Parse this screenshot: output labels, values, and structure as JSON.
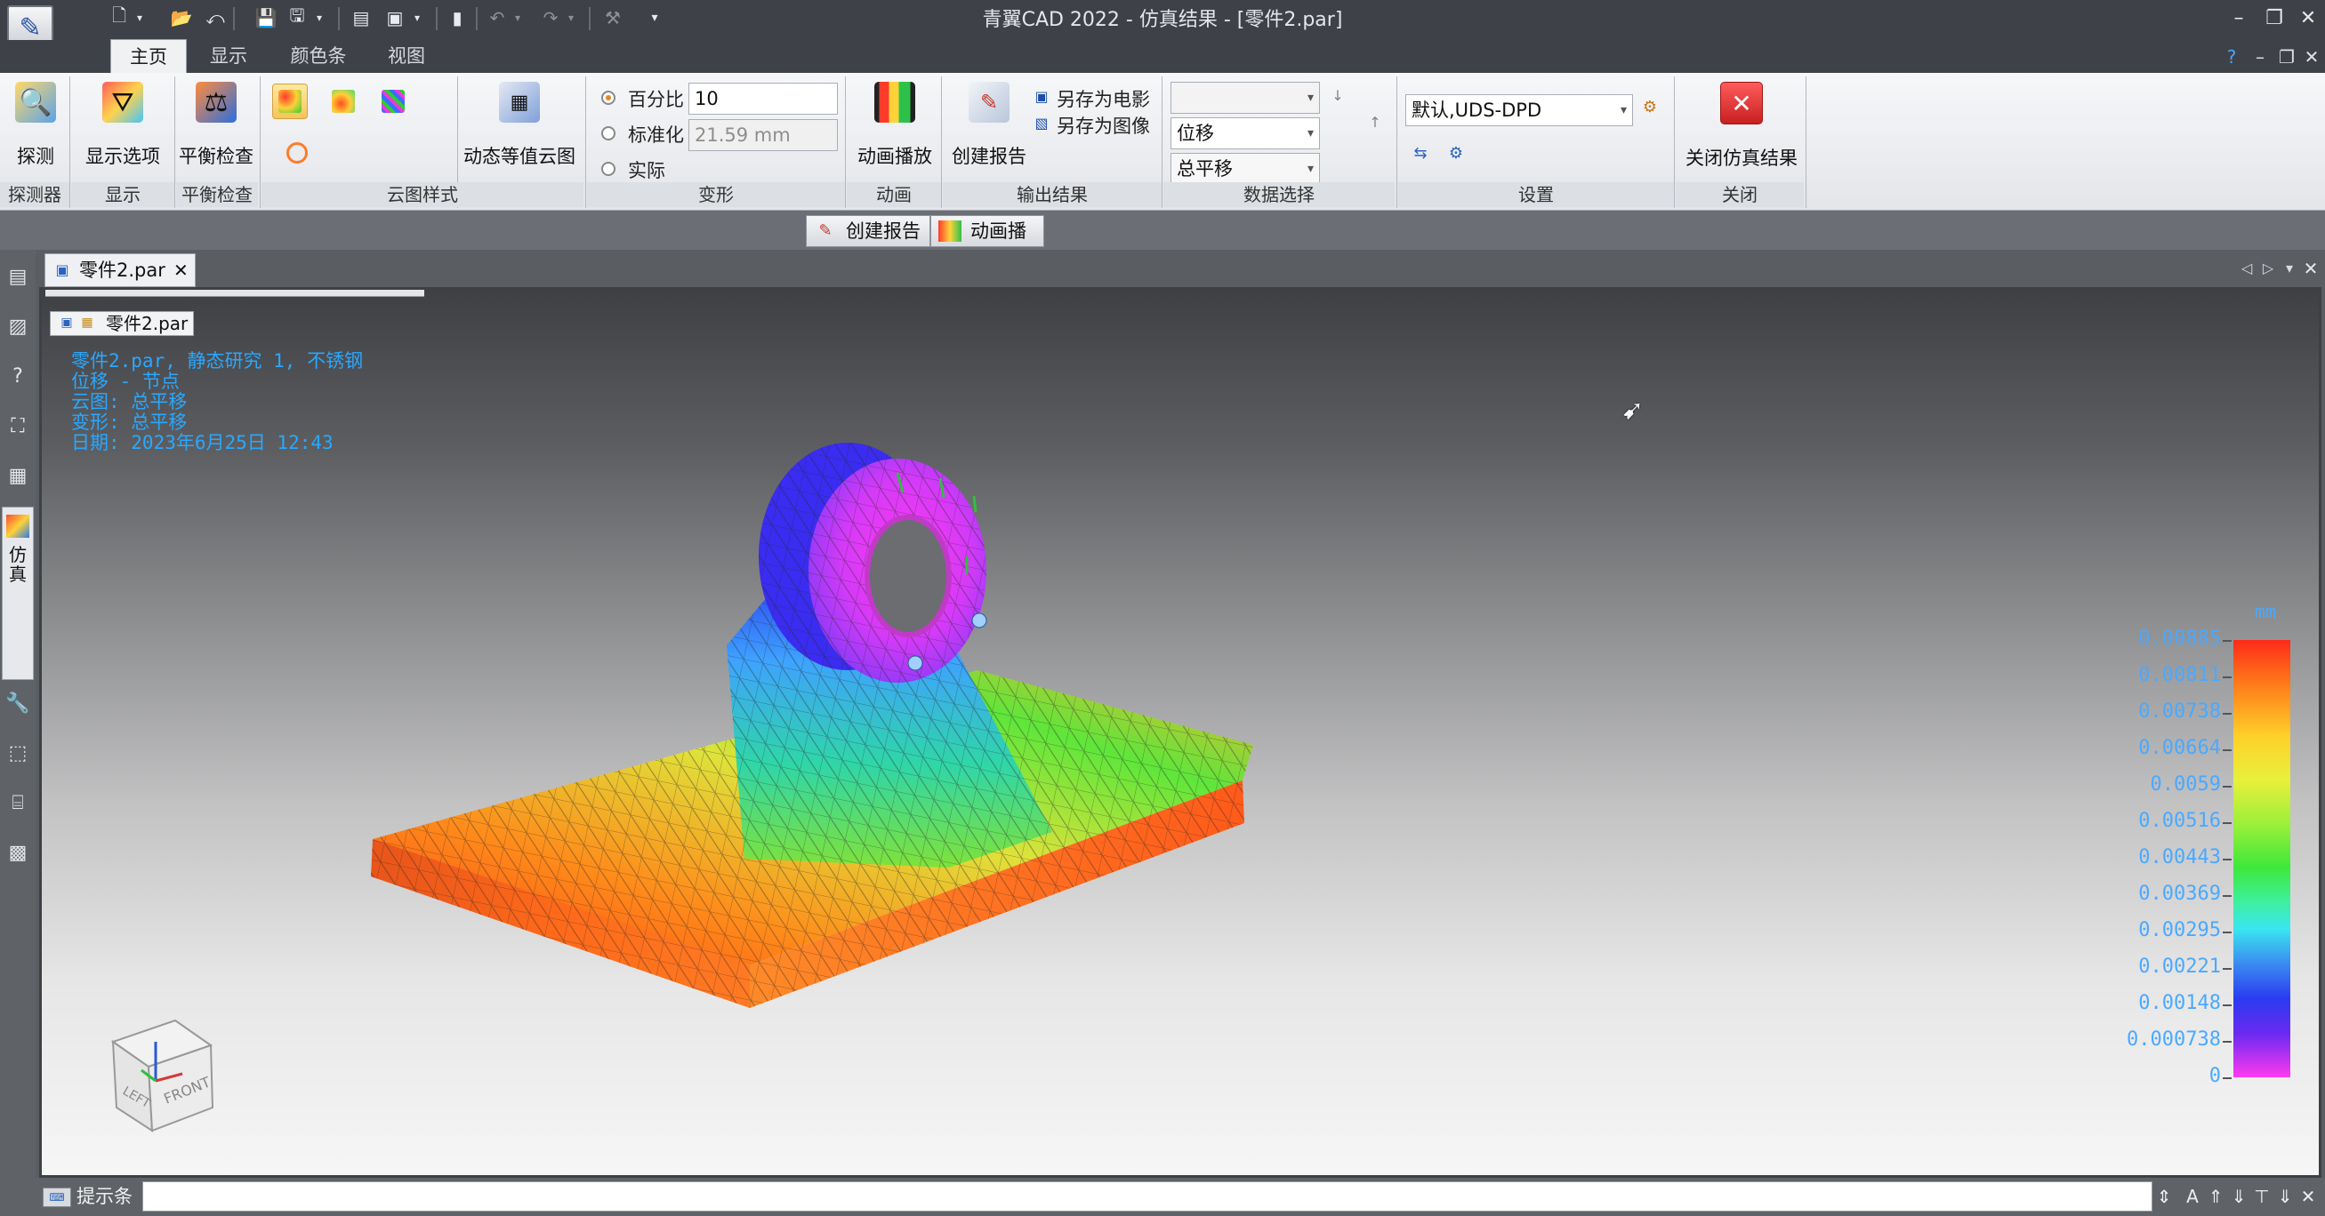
{
  "window": {
    "title": "青翼CAD 2022 - 仿真结果 - [零件2.par]"
  },
  "ribbon_tabs": [
    "主页",
    "显示",
    "颜色条",
    "视图"
  ],
  "groups": {
    "probe": {
      "button": "探测",
      "label": "探测器"
    },
    "display": {
      "button": "显示选项",
      "label": "显示"
    },
    "balance": {
      "button": "平衡检查",
      "label": "平衡检查"
    },
    "contour": {
      "button": "动态等值云图",
      "label": "云图样式"
    },
    "deform": {
      "label": "变形",
      "options": [
        "百分比",
        "标准化",
        "实际"
      ],
      "percent_value": "10",
      "normalized_value": "21.59 mm"
    },
    "animation": {
      "button": "动画播放",
      "label": "动画"
    },
    "output": {
      "button": "创建报告",
      "save_movie": "另存为电影",
      "save_image": "另存为图像",
      "label": "输出结果"
    },
    "data_select": {
      "combo_top": "",
      "combo_type": "位移",
      "combo_component": "总平移",
      "label": "数据选择"
    },
    "settings": {
      "combo": "默认,UDS-DPD",
      "label": "设置"
    },
    "close": {
      "button": "关闭仿真结果",
      "label": "关闭"
    }
  },
  "quick_bar": {
    "create_report": "创建报告",
    "play_animation": "动画播放"
  },
  "sidebar": {
    "sim_tab": "仿真"
  },
  "document_tab": "零件2.par",
  "viewport_title": "零件2.par",
  "study_info": [
    "零件2.par, 静态研究 1, 不锈钢",
    "位移 - 节点",
    "云图: 总平移",
    "变形: 总平移",
    "日期: 2023年6月25日  12:43"
  ],
  "colorbar": {
    "unit": "mm",
    "ticks": [
      "0.00885",
      "0.00811",
      "0.00738",
      "0.00664",
      "0.0059",
      "0.00516",
      "0.00443",
      "0.00369",
      "0.00295",
      "0.00221",
      "0.00148",
      "0.000738",
      "0"
    ]
  },
  "view_cube": {
    "face_front": "FRONT",
    "face_left": "LEFT"
  },
  "status": {
    "label": "提示条",
    "value": ""
  },
  "colors": {
    "accent": "#29a8ff",
    "titlebar": "#3e4147",
    "close_red": "#d93333"
  }
}
